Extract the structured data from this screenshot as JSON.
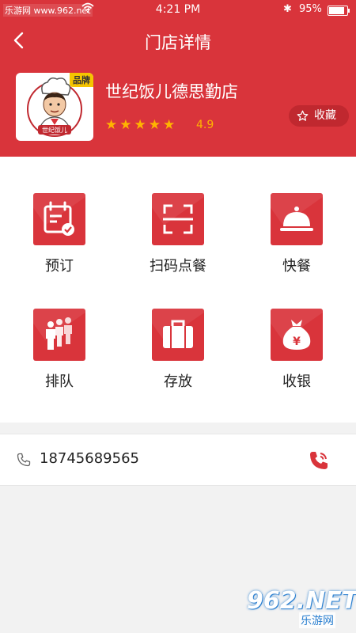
{
  "status_bar": {
    "carrier": "乐游网 www.962.net",
    "time": "4:21 PM",
    "battery": "95%",
    "battery_level": 0.95
  },
  "nav": {
    "title": "门店详情"
  },
  "store": {
    "name": "世纪饭儿德思勤店",
    "badge": "品牌",
    "logo_text": "世纪饭儿",
    "stars": 5,
    "rating": "4.9",
    "collect_label": "收藏",
    "accent_color": "#d9343b",
    "star_color": "#ffb400"
  },
  "services": [
    {
      "label": "预订",
      "icon": "calendar-check-icon"
    },
    {
      "label": "扫码点餐",
      "icon": "scan-icon"
    },
    {
      "label": "快餐",
      "icon": "cloche-icon"
    },
    {
      "label": "排队",
      "icon": "queue-people-icon"
    },
    {
      "label": "存放",
      "icon": "luggage-icon"
    },
    {
      "label": "收银",
      "icon": "money-bag-icon"
    }
  ],
  "contact": {
    "phone": "18745689565"
  },
  "watermark": {
    "number": "962.NET",
    "sub": "乐游网"
  }
}
